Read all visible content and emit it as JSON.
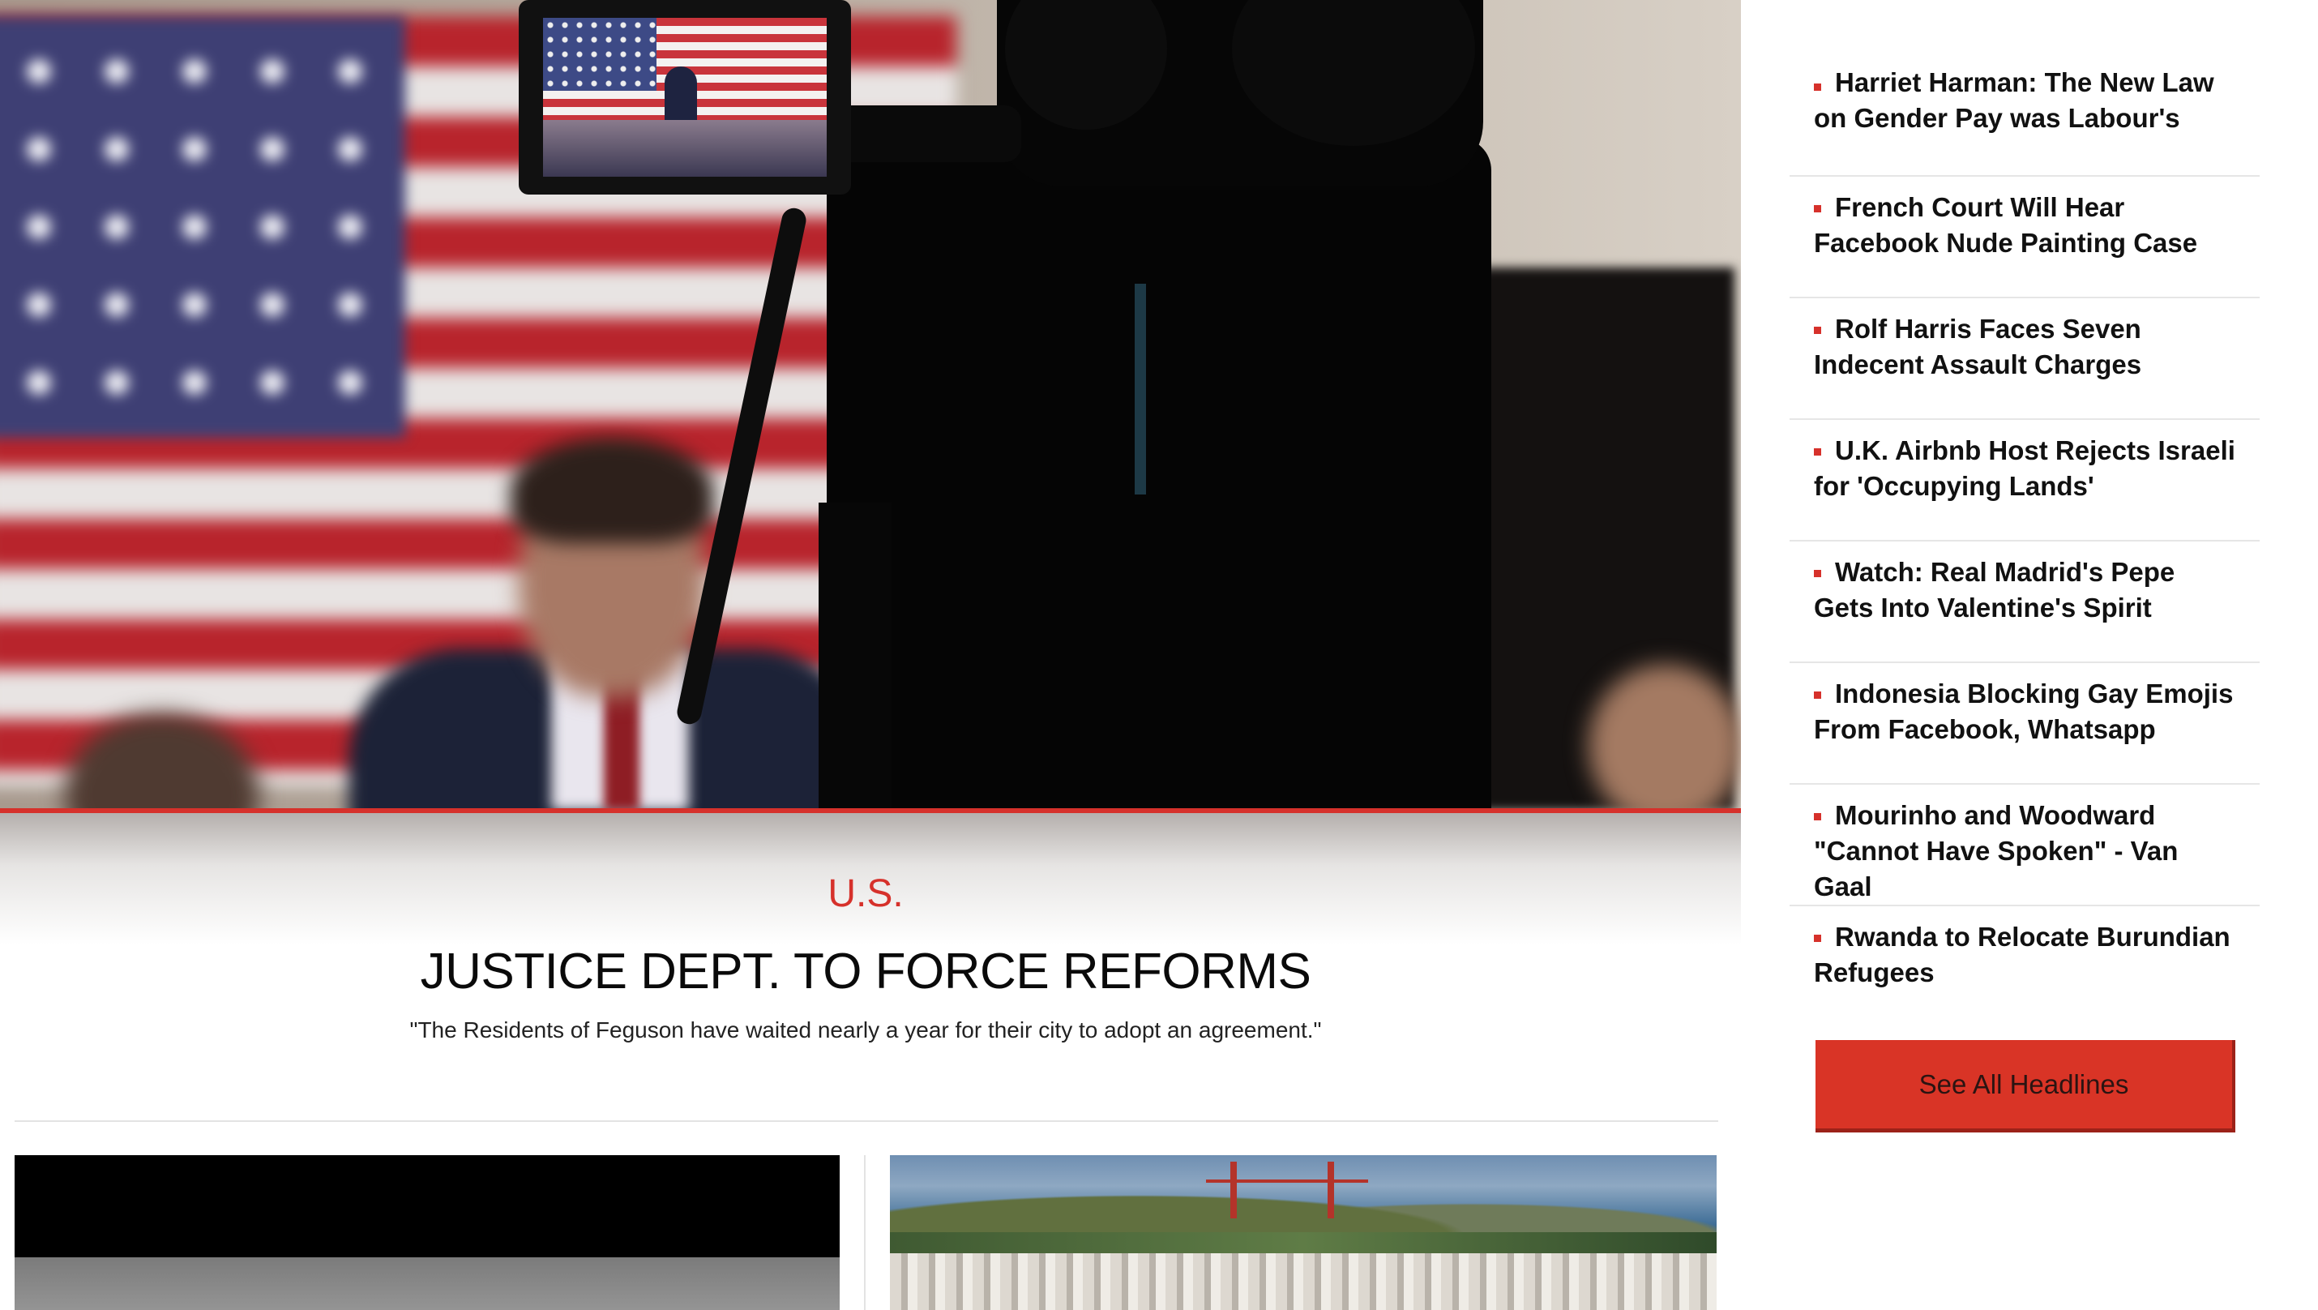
{
  "hero": {
    "category": "U.S.",
    "headline": "JUSTICE DEPT. TO FORCE REFORMS",
    "dek": "\"The Residents of Feguson have waited nearly a year for their city to adopt an agreement.\""
  },
  "colors": {
    "accent": "#d6312b",
    "button": "#d93426",
    "divider": "#e3e3e3"
  },
  "sidebar": {
    "headlines": [
      {
        "title": "Harriet Harman: The New Law on Gender Pay was Labour's"
      },
      {
        "title": "French Court Will Hear Facebook Nude Painting Case"
      },
      {
        "title": "Rolf Harris Faces Seven Indecent Assault Charges"
      },
      {
        "title": "U.K. Airbnb Host Rejects Israeli for 'Occupying Lands'"
      },
      {
        "title": "Watch: Real Madrid's Pepe Gets Into Valentine's Spirit"
      },
      {
        "title": "Indonesia Blocking Gay Emojis From Facebook, Whatsapp"
      },
      {
        "title": "Mourinho and Woodward \"Cannot Have Spoken\" - Van Gaal"
      },
      {
        "title": "Rwanda to Relocate Burundian Refugees"
      }
    ],
    "see_all_label": "See All Headlines"
  }
}
